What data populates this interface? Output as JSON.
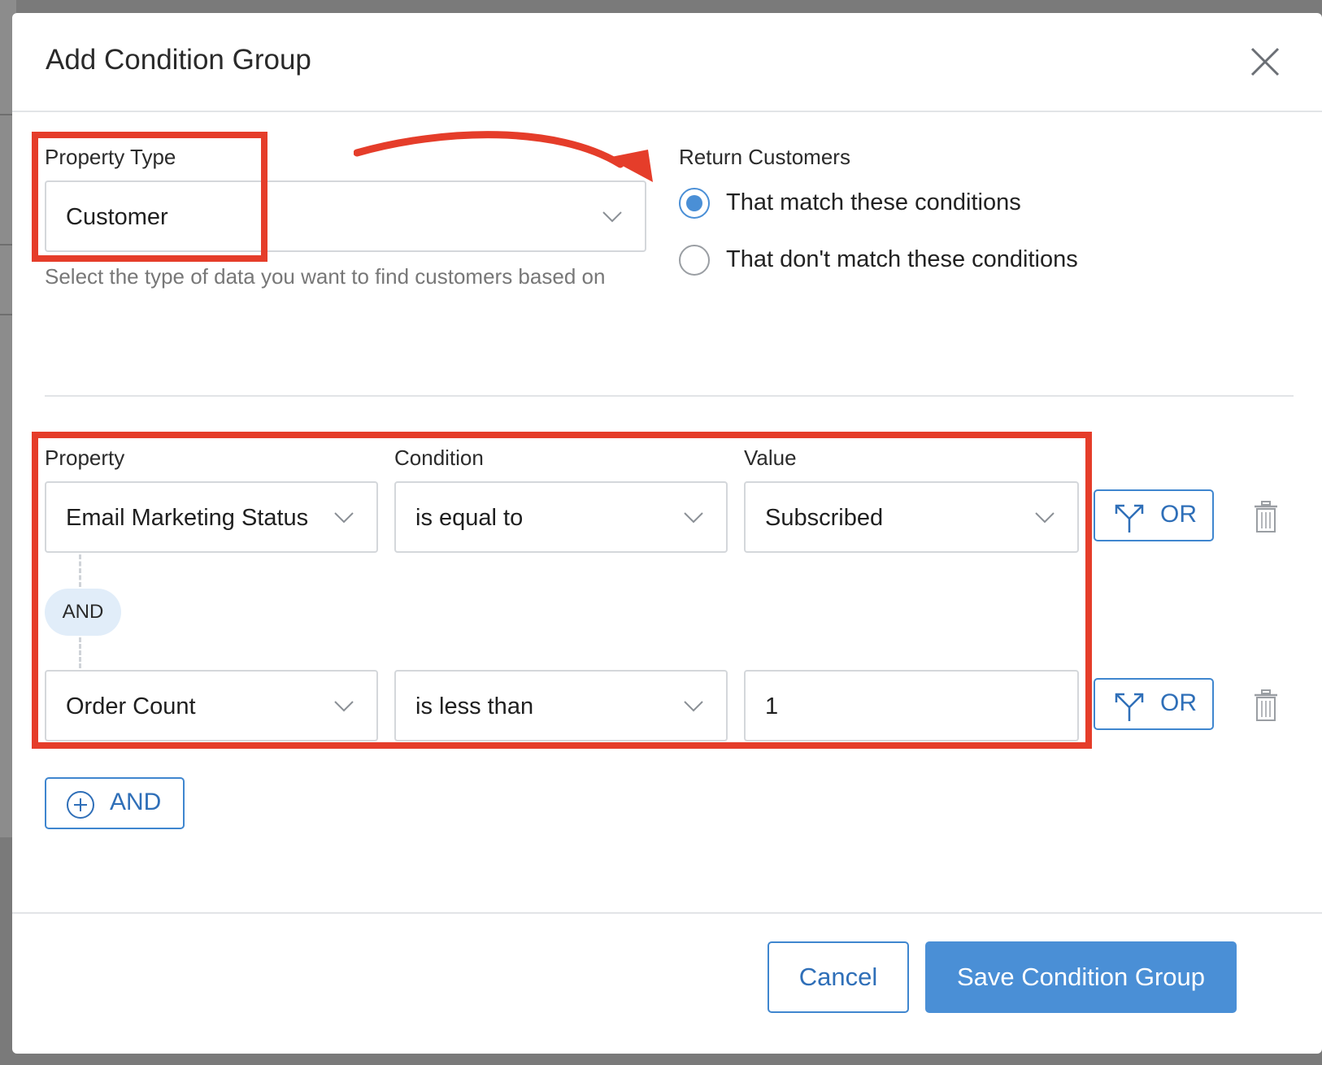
{
  "dialog": {
    "title": "Add Condition Group"
  },
  "property_type": {
    "label": "Property Type",
    "value": "Customer",
    "help": "Select the type of data you want to find customers based on"
  },
  "return_customers": {
    "label": "Return Customers",
    "options": [
      {
        "label": "That match these conditions",
        "selected": true
      },
      {
        "label": "That don't match these conditions",
        "selected": false
      }
    ]
  },
  "conditions": {
    "headers": {
      "property": "Property",
      "condition": "Condition",
      "value": "Value"
    },
    "rows": [
      {
        "property": "Email Marketing Status",
        "condition": "is equal to",
        "value": "Subscribed",
        "or_label": "OR"
      },
      {
        "property": "Order Count",
        "condition": "is less than",
        "value": "1",
        "or_label": "OR"
      }
    ],
    "connector": "AND"
  },
  "add_and_label": "AND",
  "footer": {
    "cancel_label": "Cancel",
    "save_label": "Save Condition Group"
  },
  "colors": {
    "accent": "#4a8fd6",
    "annotation": "#e53d2a"
  }
}
